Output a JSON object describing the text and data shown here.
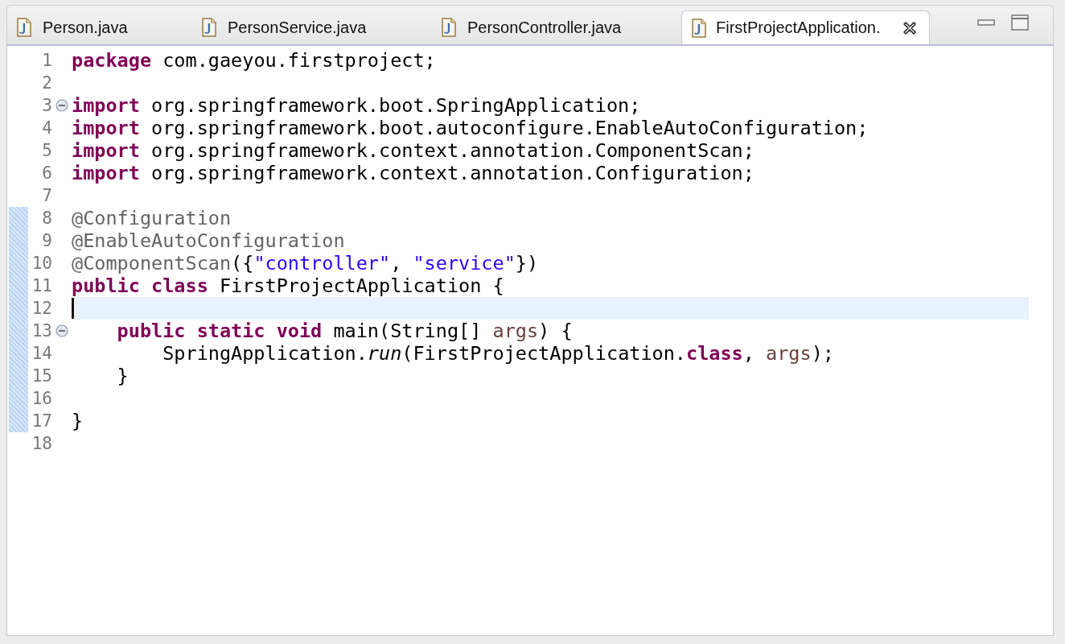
{
  "tabs": [
    {
      "label": "Person.java",
      "selected": false,
      "closable": false
    },
    {
      "label": "PersonService.java",
      "selected": false,
      "closable": false
    },
    {
      "label": "PersonController.java",
      "selected": false,
      "closable": false
    },
    {
      "label": "FirstProjectApplication.",
      "selected": true,
      "closable": true
    }
  ],
  "editor": {
    "lines": [
      {
        "number": "1",
        "fold": false,
        "changed": false,
        "current": false,
        "tokens": [
          {
            "kind": "keyword",
            "text": "package"
          },
          {
            "kind": "plain",
            "text": " com.gaeyou.firstproject;"
          }
        ]
      },
      {
        "number": "2",
        "fold": false,
        "changed": false,
        "current": false
      },
      {
        "number": "3",
        "fold": true,
        "changed": false,
        "current": false,
        "tokens": [
          {
            "kind": "keyword",
            "text": "import"
          },
          {
            "kind": "plain",
            "text": " org.springframework.boot.SpringApplication;"
          }
        ]
      },
      {
        "number": "4",
        "fold": false,
        "changed": false,
        "current": false,
        "tokens": [
          {
            "kind": "keyword",
            "text": "import"
          },
          {
            "kind": "plain",
            "text": " org.springframework.boot.autoconfigure.EnableAutoConfiguration;"
          }
        ]
      },
      {
        "number": "5",
        "fold": false,
        "changed": false,
        "current": false,
        "tokens": [
          {
            "kind": "keyword",
            "text": "import"
          },
          {
            "kind": "plain",
            "text": " org.springframework.context.annotation.ComponentScan;"
          }
        ]
      },
      {
        "number": "6",
        "fold": false,
        "changed": false,
        "current": false,
        "tokens": [
          {
            "kind": "keyword",
            "text": "import"
          },
          {
            "kind": "plain",
            "text": " org.springframework.context.annotation.Configuration;"
          }
        ]
      },
      {
        "number": "7",
        "fold": false,
        "changed": false,
        "current": false
      },
      {
        "number": "8",
        "fold": false,
        "changed": true,
        "current": false,
        "tokens": [
          {
            "kind": "annotation",
            "text": "@Configuration"
          }
        ]
      },
      {
        "number": "9",
        "fold": false,
        "changed": true,
        "current": false,
        "tokens": [
          {
            "kind": "annotation",
            "text": "@EnableAutoConfiguration"
          }
        ]
      },
      {
        "number": "10",
        "fold": false,
        "changed": true,
        "current": false,
        "tokens": [
          {
            "kind": "annotation",
            "text": "@ComponentScan"
          },
          {
            "kind": "plain",
            "text": "({"
          },
          {
            "kind": "string",
            "text": "\"controller\""
          },
          {
            "kind": "plain",
            "text": ", "
          },
          {
            "kind": "string",
            "text": "\"service\""
          },
          {
            "kind": "plain",
            "text": "})"
          }
        ]
      },
      {
        "number": "11",
        "fold": false,
        "changed": true,
        "current": false,
        "tokens": [
          {
            "kind": "keyword",
            "text": "public"
          },
          {
            "kind": "keyword",
            "text": " class"
          },
          {
            "kind": "plain",
            "text": " FirstProjectApplication {"
          }
        ]
      },
      {
        "number": "12",
        "fold": false,
        "changed": true,
        "current": true
      },
      {
        "number": "13",
        "fold": true,
        "changed": true,
        "current": false,
        "tokens": [
          {
            "kind": "keyword",
            "text": "    public"
          },
          {
            "kind": "keyword",
            "text": " static"
          },
          {
            "kind": "keyword",
            "text": " void"
          },
          {
            "kind": "plain",
            "text": " main(String[] "
          },
          {
            "kind": "variable",
            "text": "args"
          },
          {
            "kind": "plain",
            "text": ") {"
          }
        ]
      },
      {
        "number": "14",
        "fold": false,
        "changed": true,
        "current": false,
        "tokens": [
          {
            "kind": "plain",
            "text": "        SpringApplication."
          },
          {
            "kind": "static",
            "text": "run"
          },
          {
            "kind": "plain",
            "text": "(FirstProjectApplication."
          },
          {
            "kind": "keyword",
            "text": "class"
          },
          {
            "kind": "plain",
            "text": ", "
          },
          {
            "kind": "variable",
            "text": "args"
          },
          {
            "kind": "plain",
            "text": ");"
          }
        ]
      },
      {
        "number": "15",
        "fold": false,
        "changed": true,
        "current": false,
        "tokens": [
          {
            "kind": "plain",
            "text": "    }"
          }
        ]
      },
      {
        "number": "16",
        "fold": false,
        "changed": true,
        "current": false
      },
      {
        "number": "17",
        "fold": false,
        "changed": true,
        "current": false,
        "tokens": [
          {
            "kind": "plain",
            "text": "}"
          }
        ]
      },
      {
        "number": "18",
        "fold": false,
        "changed": false,
        "current": false
      }
    ]
  }
}
